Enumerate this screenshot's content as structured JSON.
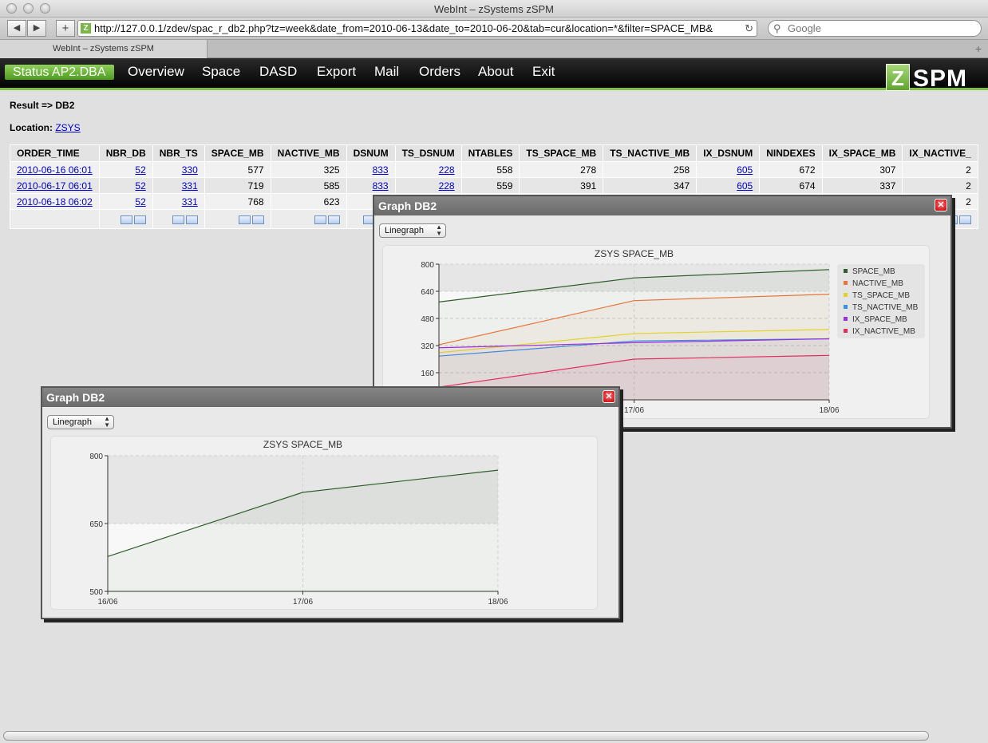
{
  "browser": {
    "window_title": "WebInt – zSystems zSPM",
    "url": "http://127.0.0.1/zdev/spac_r_db2.php?tz=week&date_from=2010-06-13&date_to=2010-06-20&tab=cur&location=*&filter=SPACE_MB&",
    "search_placeholder": "Google",
    "tab_title": "WebInt – zSystems zSPM"
  },
  "menu": {
    "status": "Status AP2.DBA",
    "items": [
      "Overview",
      "Space",
      "DASD",
      "Export",
      "Mail",
      "Orders",
      "About",
      "Exit"
    ],
    "logo_z": "Z",
    "logo_text": "SPM"
  },
  "page": {
    "result_label": "Result => DB2",
    "location_label": "Location:",
    "location_value": "ZSYS"
  },
  "table": {
    "headers": [
      "ORDER_TIME",
      "NBR_DB",
      "NBR_TS",
      "SPACE_MB",
      "NACTIVE_MB",
      "DSNUM",
      "TS_DSNUM",
      "NTABLES",
      "TS_SPACE_MB",
      "TS_NACTIVE_MB",
      "IX_DSNUM",
      "NINDEXES",
      "IX_SPACE_MB",
      "IX_NACTIVE_"
    ],
    "rows": [
      [
        "2010-06-16 06:01",
        "52",
        "330",
        "577",
        "325",
        "833",
        "228",
        "558",
        "278",
        "258",
        "605",
        "672",
        "307",
        "2"
      ],
      [
        "2010-06-17 06:01",
        "52",
        "331",
        "719",
        "585",
        "833",
        "228",
        "559",
        "391",
        "347",
        "605",
        "674",
        "337",
        "2"
      ],
      [
        "2010-06-18 06:02",
        "52",
        "331",
        "768",
        "623",
        "",
        "",
        "",
        "",
        "",
        "",
        "",
        "",
        "2"
      ]
    ]
  },
  "graph_windows": [
    {
      "title": "Graph DB2",
      "select_value": "Linegraph"
    },
    {
      "title": "Graph DB2",
      "select_value": "Linegraph"
    }
  ],
  "chart_data": [
    {
      "type": "area",
      "title": "ZSYS SPACE_MB",
      "categories": [
        "16/06",
        "17/06",
        "18/06"
      ],
      "ylim": [
        0,
        800
      ],
      "yticks": [
        160,
        320,
        480,
        640,
        800
      ],
      "grid": true,
      "legend": "right",
      "series": [
        {
          "name": "SPACE_MB",
          "color": "#2e5e2a",
          "values": [
            577,
            719,
            768
          ]
        },
        {
          "name": "NACTIVE_MB",
          "color": "#e8743a",
          "values": [
            325,
            585,
            623
          ]
        },
        {
          "name": "TS_SPACE_MB",
          "color": "#e2d22a",
          "values": [
            278,
            391,
            415
          ]
        },
        {
          "name": "TS_NACTIVE_MB",
          "color": "#3a8fe0",
          "values": [
            258,
            347,
            360
          ]
        },
        {
          "name": "IX_SPACE_MB",
          "color": "#9a30e0",
          "values": [
            307,
            337,
            360
          ]
        },
        {
          "name": "IX_NACTIVE_MB",
          "color": "#e0305e",
          "values": [
            75,
            240,
            262
          ]
        }
      ]
    },
    {
      "type": "area",
      "title": "ZSYS SPACE_MB",
      "categories": [
        "16/06",
        "17/06",
        "18/06"
      ],
      "ylim": [
        500,
        800
      ],
      "yticks": [
        500,
        650,
        800
      ],
      "grid": true,
      "series": [
        {
          "name": "SPACE_MB",
          "color": "#2e5e2a",
          "values": [
            577,
            719,
            768
          ]
        }
      ]
    }
  ]
}
